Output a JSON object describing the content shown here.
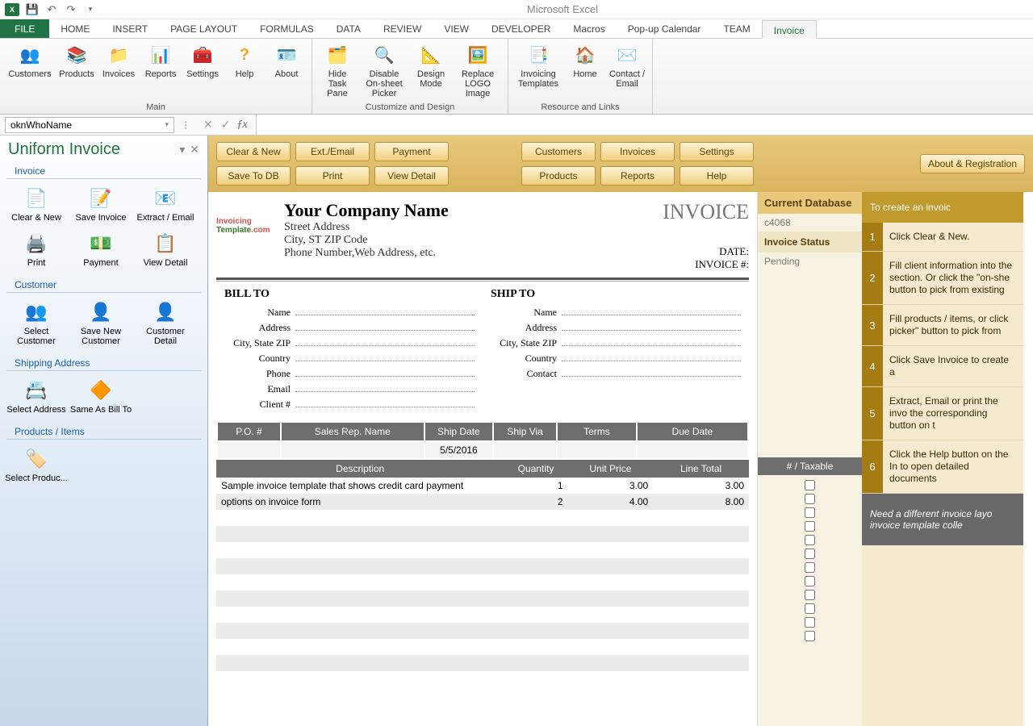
{
  "app_title": "Microsoft Excel",
  "tabs": {
    "file": "FILE",
    "home": "HOME",
    "insert": "INSERT",
    "pagelayout": "PAGE LAYOUT",
    "formulas": "FORMULAS",
    "data": "DATA",
    "review": "REVIEW",
    "view": "VIEW",
    "developer": "DEVELOPER",
    "macros": "Macros",
    "popup": "Pop-up Calendar",
    "team": "TEAM",
    "invoice": "Invoice"
  },
  "ribbon": {
    "customers": "Customers",
    "products": "Products",
    "invoices": "Invoices",
    "reports": "Reports",
    "settings": "Settings",
    "help": "Help",
    "about": "About",
    "hidepane": "Hide Task Pane",
    "disable": "Disable On-sheet Picker",
    "design": "Design Mode",
    "replace": "Replace LOGO Image",
    "templates": "Invoicing Templates",
    "homebtn": "Home",
    "contact": "Contact / Email",
    "group_main": "Main",
    "group_customize": "Customize and Design",
    "group_resource": "Resource and Links"
  },
  "namebox": "oknWhoName",
  "taskpane": {
    "title": "Uniform Invoice",
    "g_invoice": "Invoice",
    "g_customer": "Customer",
    "g_ship": "Shipping Address",
    "g_products": "Products / Items",
    "clear": "Clear & New",
    "save": "Save Invoice",
    "extract": "Extract / Email",
    "print": "Print",
    "payment": "Payment",
    "viewdetail": "View Detail",
    "selcust": "Select Customer",
    "newcust": "Save New Customer",
    "custdetail": "Customer Detail",
    "seladdr": "Select Address",
    "sameas": "Same As Bill To",
    "selprod": "Select Produc..."
  },
  "goldbar": {
    "clear": "Clear & New",
    "ext": "Ext./Email",
    "payment": "Payment",
    "savedb": "Save To DB",
    "print": "Print",
    "viewdetail": "View Detail",
    "customers": "Customers",
    "invoices": "Invoices",
    "settings": "Settings",
    "products": "Products",
    "reports": "Reports",
    "help": "Help",
    "aboutreg": "About & Registration"
  },
  "invoice": {
    "company": "Your Company Name",
    "street": "Street Address",
    "citystate": "City, ST  ZIP Code",
    "contact": "Phone Number,Web Address, etc.",
    "title": "INVOICE",
    "date_lbl": "DATE:",
    "num_lbl": "INVOICE #:",
    "billto": "BILL TO",
    "shipto": "SHIP TO",
    "f_name": "Name",
    "f_addr": "Address",
    "f_csz": "City, State ZIP",
    "f_country": "Country",
    "f_phone": "Phone",
    "f_email": "Email",
    "f_client": "Client #",
    "f_contact": "Contact",
    "hdrs": {
      "po": "P.O. #",
      "rep": "Sales Rep. Name",
      "shipdate": "Ship Date",
      "shipvia": "Ship Via",
      "terms": "Terms",
      "due": "Due Date"
    },
    "shipdate_val": "5/5/2016",
    "cols": {
      "desc": "Description",
      "qty": "Quantity",
      "price": "Unit Price",
      "total": "Line Total"
    },
    "rows": [
      {
        "desc": "Sample invoice template that shows credit card payment",
        "qty": "1",
        "price": "3.00",
        "total": "3.00"
      },
      {
        "desc": "options on invoice form",
        "qty": "2",
        "price": "4.00",
        "total": "8.00"
      }
    ]
  },
  "sideA": {
    "dbhdr": "Current Database",
    "dbval": "c4068",
    "sthdr": "Invoice Status",
    "stval": "Pending",
    "taxhdr": "# / Taxable"
  },
  "sideB": {
    "top": "To create an invoic",
    "steps": [
      "Click Clear & New.",
      "Fill client information into the section. Or click the \"on-she button to pick from existing",
      "Fill products / items, or click picker\" button to pick from",
      "Click Save Invoice to create a",
      "Extract, Email or print the invo the corresponding button on t",
      "Click the Help button on the In to open detailed documents"
    ],
    "foot": "Need a different invoice layo invoice template colle"
  }
}
